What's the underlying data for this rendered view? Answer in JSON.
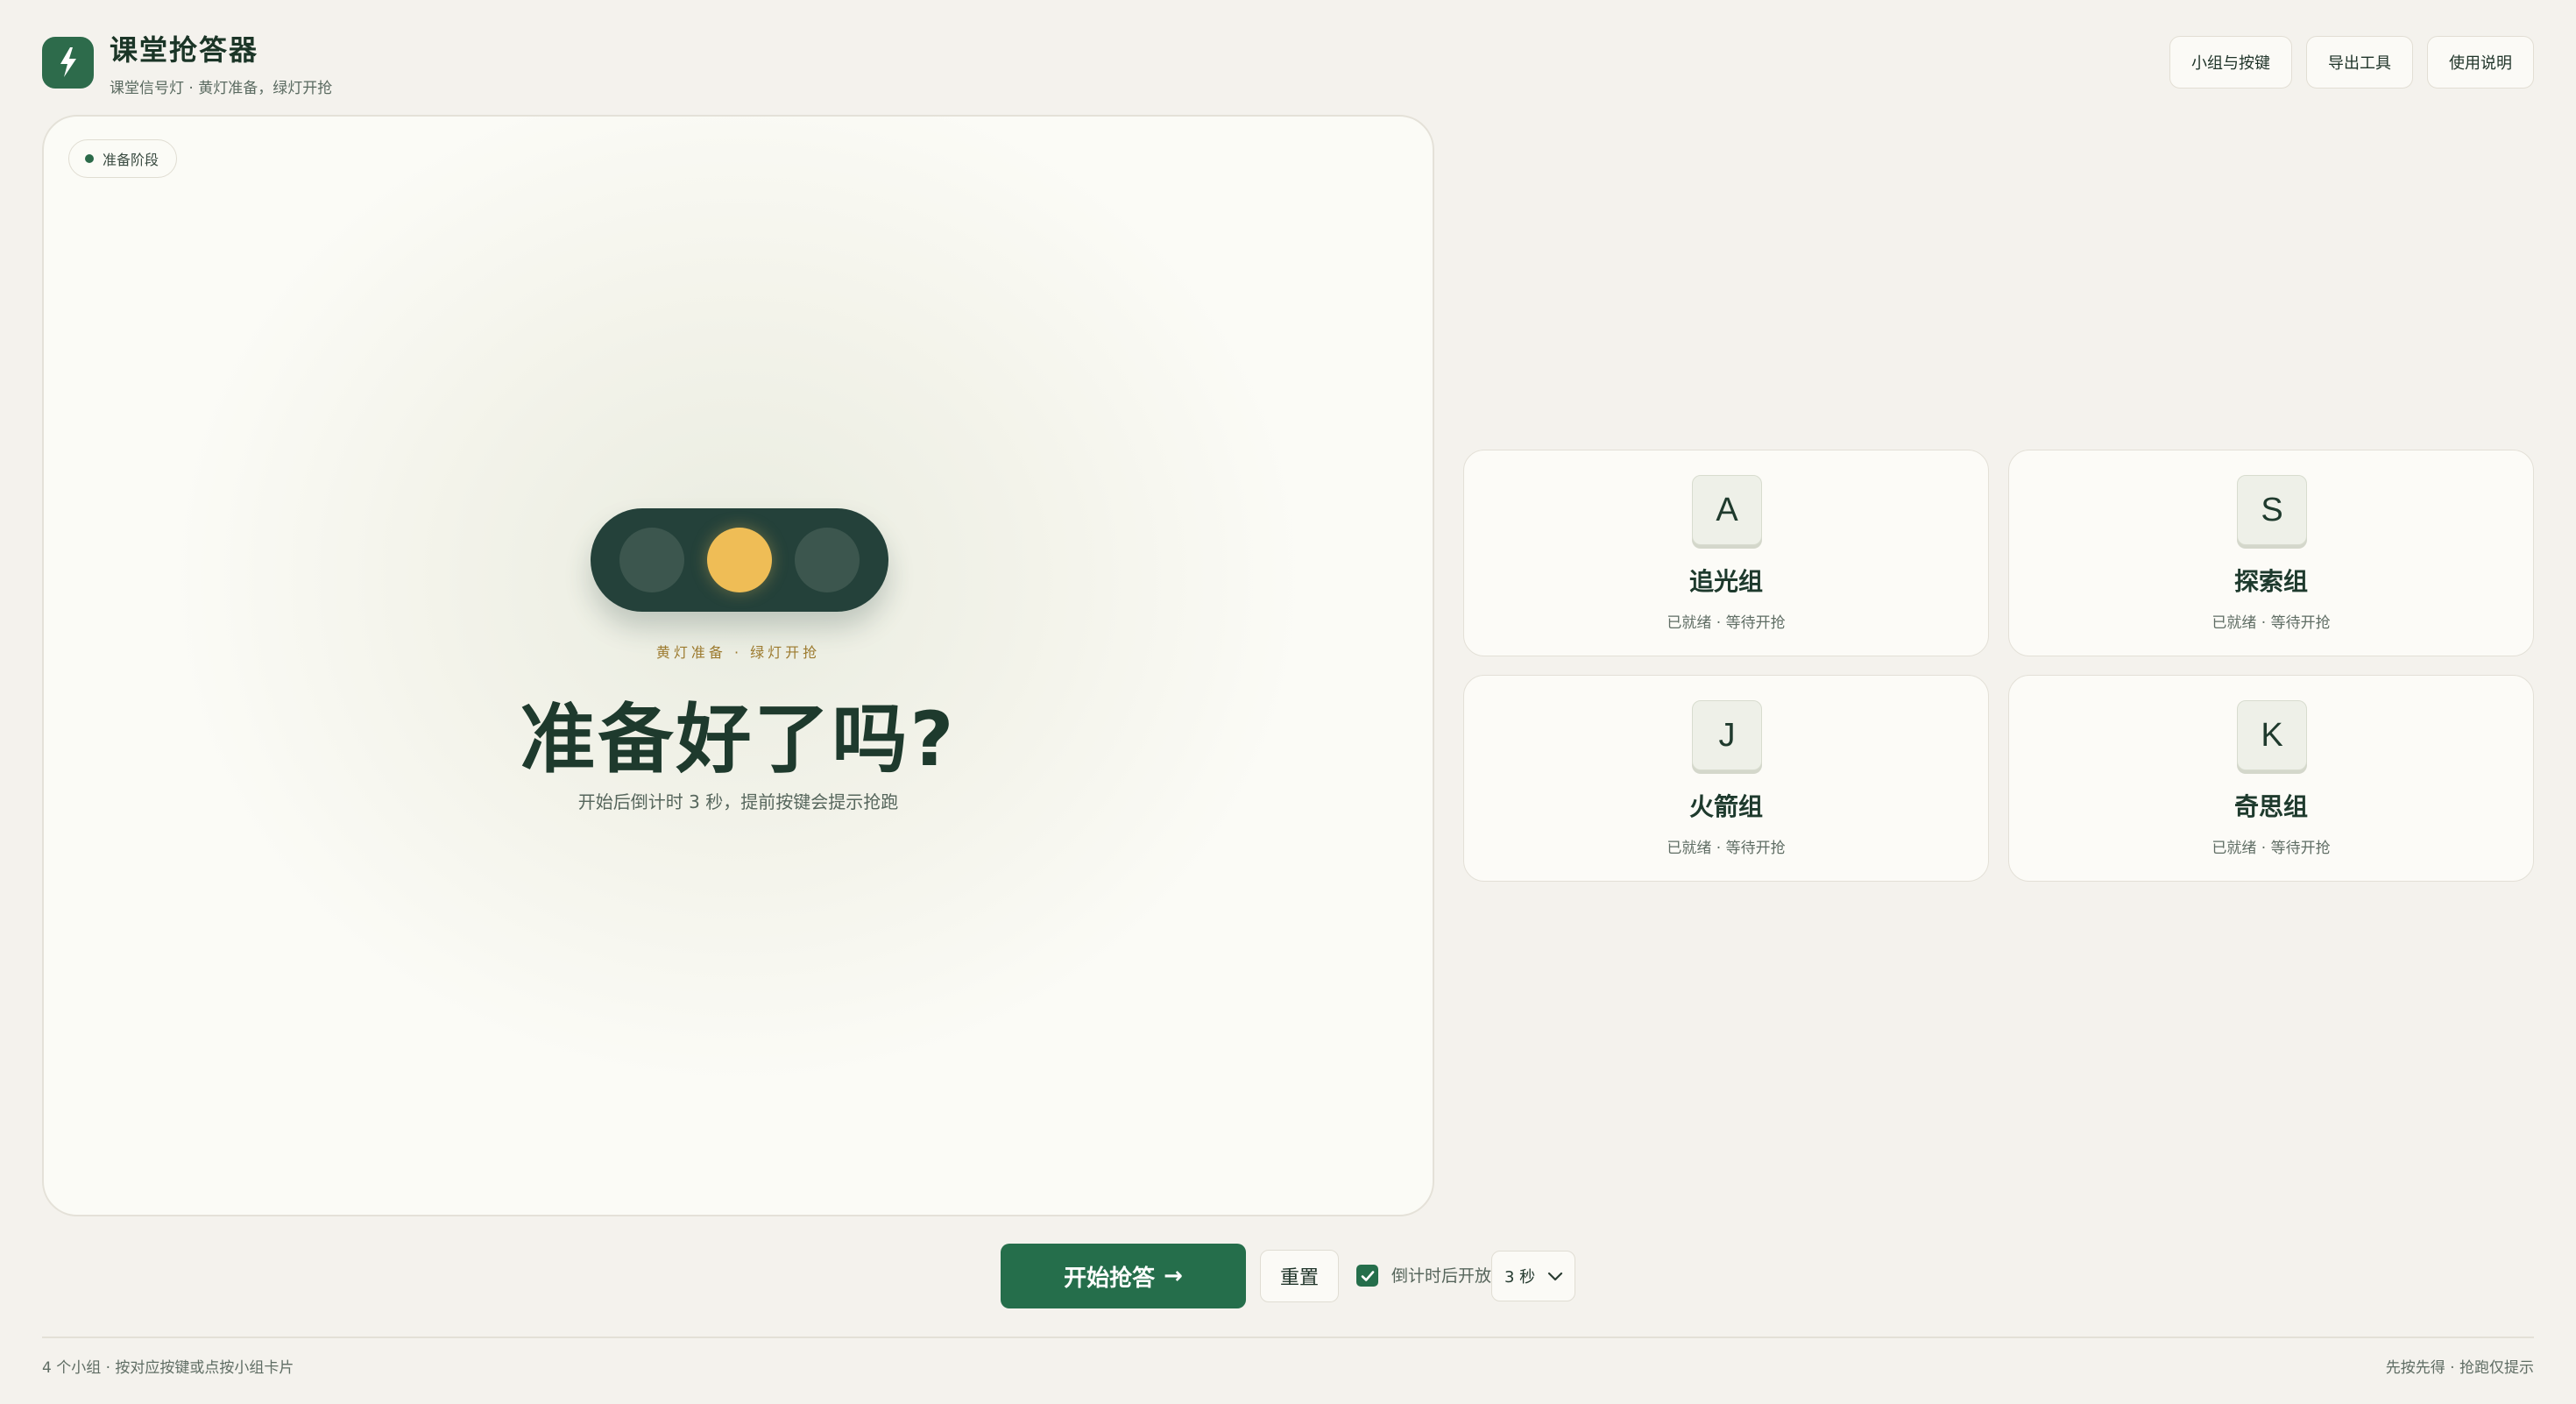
{
  "app": {
    "title": "课堂抢答器",
    "subtitle": "课堂信号灯 · 黄灯准备，绿灯开抢",
    "logo_icon": "lightning-icon",
    "accent_color": "#256e4b"
  },
  "header": {
    "actions": [
      {
        "label": "小组与按键"
      },
      {
        "label": "导出工具"
      },
      {
        "label": "使用说明"
      }
    ]
  },
  "stage": {
    "phase_badge": "准备阶段",
    "signal": {
      "bulbs": [
        "off",
        "yellow",
        "off"
      ],
      "active_color": "#efbd56"
    },
    "hint": "黄灯准备 · 绿灯开抢",
    "title": "准备好了吗?",
    "description": "开始后倒计时 3 秒，提前按键会提示抢跑"
  },
  "teams": [
    {
      "key": "A",
      "name": "追光组",
      "status": "已就绪 · 等待开抢"
    },
    {
      "key": "S",
      "name": "探索组",
      "status": "已就绪 · 等待开抢"
    },
    {
      "key": "J",
      "name": "火箭组",
      "status": "已就绪 · 等待开抢"
    },
    {
      "key": "K",
      "name": "奇思组",
      "status": "已就绪 · 等待开抢"
    }
  ],
  "controls": {
    "start_label": "开始抢答",
    "start_arrow": "→",
    "reset_label": "重置",
    "countdown_checkbox": {
      "label": "倒计时后开放",
      "checked": true
    },
    "countdown_select": {
      "value": "3 秒"
    }
  },
  "footer": {
    "left": "4 个小组 · 按对应按键或点按小组卡片",
    "right": "先按先得 · 抢跑仅提示"
  }
}
